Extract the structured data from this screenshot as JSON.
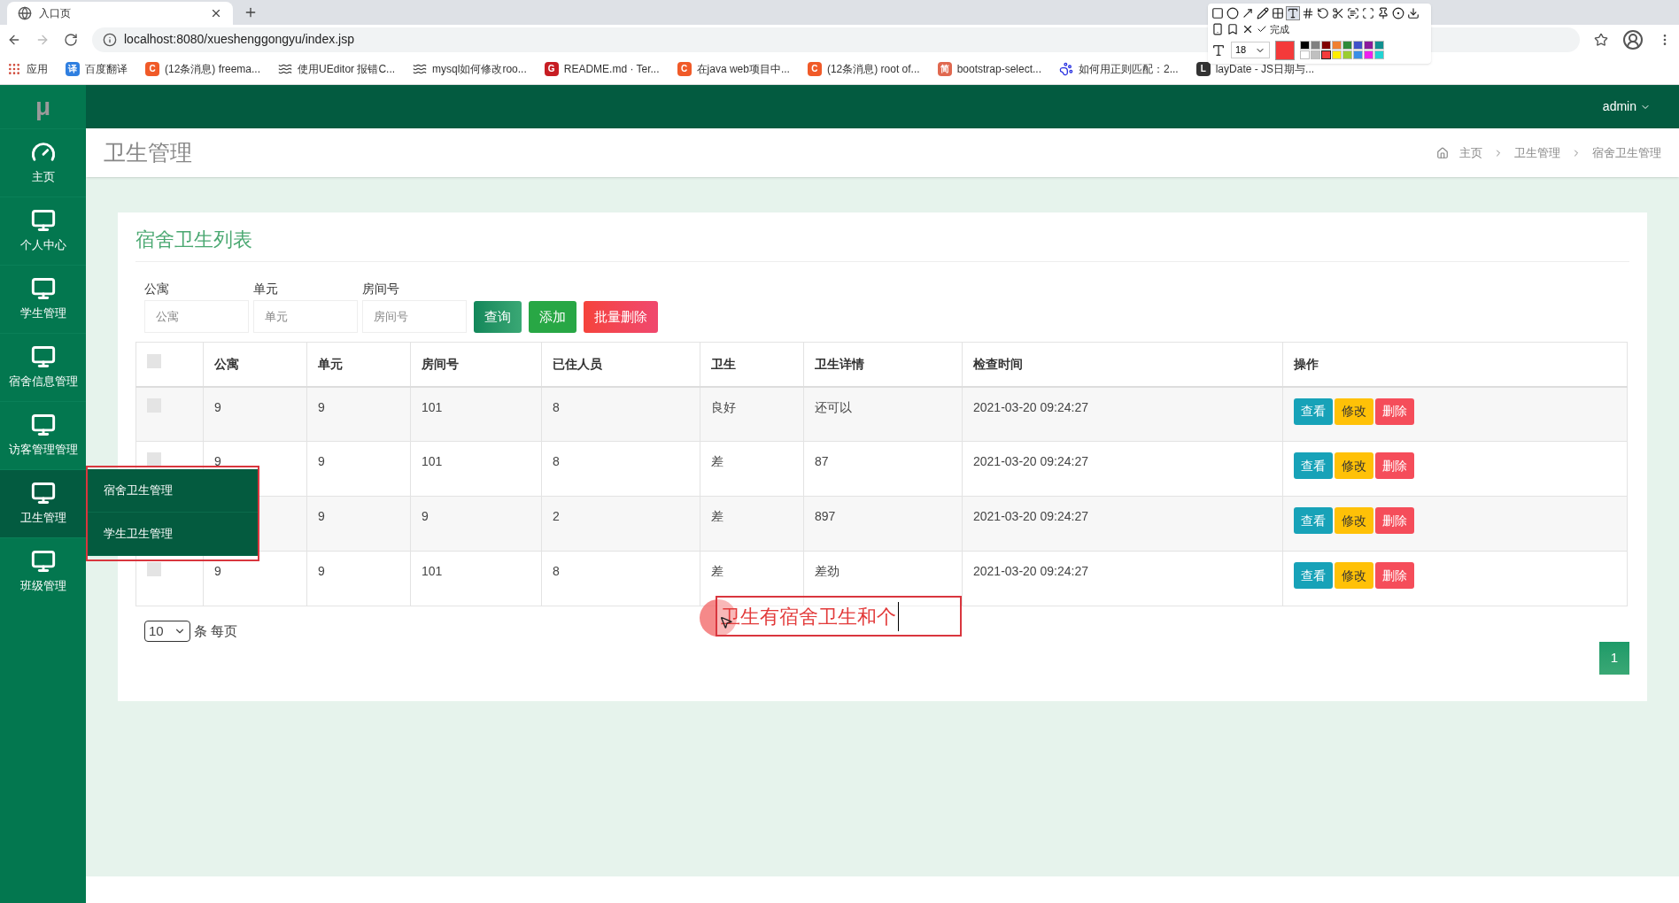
{
  "browser": {
    "tab_title": "入口页",
    "url": "localhost:8080/xueshenggongyu/index.jsp",
    "bookmarks": [
      {
        "label": "应用",
        "kind": "apps"
      },
      {
        "label": "百度翻译",
        "kind": "letter",
        "glyph": "译",
        "color": "#2f7fe0"
      },
      {
        "label": "(12条消息) freema...",
        "kind": "letter",
        "glyph": "C",
        "color": "#f05a28"
      },
      {
        "label": "使用UEditor 报错C...",
        "kind": "swirl"
      },
      {
        "label": "mysql如何修改roo...",
        "kind": "swirl"
      },
      {
        "label": "README.md · Ter...",
        "kind": "letter",
        "glyph": "G",
        "color": "#c71d23"
      },
      {
        "label": "在java web项目中...",
        "kind": "letter",
        "glyph": "C",
        "color": "#f05a28"
      },
      {
        "label": "(12条消息) root of...",
        "kind": "letter",
        "glyph": "C",
        "color": "#f05a28"
      },
      {
        "label": "bootstrap-select...",
        "kind": "letter",
        "glyph": "简",
        "color": "#e0684f"
      },
      {
        "label": "如何用正则匹配：2...",
        "kind": "paw"
      },
      {
        "label": "layDate - JS日期与...",
        "kind": "letter",
        "glyph": "L",
        "color": "#333333"
      }
    ]
  },
  "capture_toolbar": {
    "tools": [
      {
        "kind": "rect",
        "selected": false
      },
      {
        "kind": "circle",
        "selected": false
      },
      {
        "kind": "arrow",
        "selected": false
      },
      {
        "kind": "pen",
        "selected": false
      },
      {
        "kind": "mosaic",
        "selected": false
      },
      {
        "kind": "text",
        "selected": true
      },
      {
        "kind": "number",
        "selected": false
      },
      {
        "kind": "undo",
        "selected": false
      },
      {
        "kind": "cut",
        "selected": false
      },
      {
        "kind": "ocr",
        "selected": false
      },
      {
        "kind": "scan",
        "selected": false
      },
      {
        "kind": "pin",
        "selected": false
      },
      {
        "kind": "record",
        "selected": false
      },
      {
        "kind": "download",
        "selected": false
      },
      {
        "kind": "phone",
        "selected": false
      },
      {
        "kind": "bookmark",
        "selected": false
      },
      {
        "kind": "close",
        "selected": false
      }
    ],
    "done_label": "完成",
    "font_size": "18",
    "palette": [
      {
        "color": "#000000",
        "selected": false
      },
      {
        "color": "#808080",
        "selected": false
      },
      {
        "color": "#800000",
        "selected": false
      },
      {
        "color": "#f08030",
        "selected": false
      },
      {
        "color": "#2e8b3a",
        "selected": false
      },
      {
        "color": "#3f51c8",
        "selected": false
      },
      {
        "color": "#8b1a9b",
        "selected": false
      },
      {
        "color": "#109090",
        "selected": false
      },
      {
        "color": "#ffffff",
        "selected": false
      },
      {
        "color": "#c0c0c0",
        "selected": false
      },
      {
        "color": "#f43a3a",
        "selected": true
      },
      {
        "color": "#ffee00",
        "selected": false
      },
      {
        "color": "#9acd32",
        "selected": false
      },
      {
        "color": "#3a8ee6",
        "selected": false
      },
      {
        "color": "#ee22ee",
        "selected": false
      },
      {
        "color": "#22d3d3",
        "selected": false
      }
    ]
  },
  "app": {
    "logo": "μ",
    "user": "admin",
    "sidebar": [
      {
        "label": "主页",
        "kind": "dashboard",
        "selected": false
      },
      {
        "label": "个人中心",
        "kind": "monitor",
        "selected": false
      },
      {
        "label": "学生管理",
        "kind": "monitor",
        "selected": false
      },
      {
        "label": "宿舍信息管理",
        "kind": "monitor",
        "selected": false
      },
      {
        "label": "访客管理管理",
        "kind": "monitor",
        "selected": false
      },
      {
        "label": "卫生管理",
        "kind": "monitor",
        "selected": true
      },
      {
        "label": "班级管理",
        "kind": "monitor",
        "selected": false
      }
    ],
    "flyout": [
      "宿舍卫生管理",
      "学生卫生管理"
    ],
    "page_title": "卫生管理",
    "breadcrumb": [
      "主页",
      "卫生管理",
      "宿舍卫生管理"
    ]
  },
  "card": {
    "title": "宿舍卫生列表",
    "filters": [
      {
        "label": "公寓",
        "placeholder": "公寓"
      },
      {
        "label": "单元",
        "placeholder": "单元"
      },
      {
        "label": "房间号",
        "placeholder": "房间号"
      }
    ],
    "buttons": [
      {
        "label": "查询",
        "kind": "search"
      },
      {
        "label": "添加",
        "kind": "add"
      },
      {
        "label": "批量删除",
        "kind": "delete"
      }
    ],
    "columns": [
      "公寓",
      "单元",
      "房间号",
      "已住人员",
      "卫生",
      "卫生详情",
      "检查时间",
      "操作"
    ],
    "header_checked": false,
    "rows": [
      {
        "checked": false,
        "cells": [
          "9",
          "9",
          "101",
          "8",
          "良好",
          "还可以",
          "2021-03-20 09:24:27"
        ],
        "actions": [
          {
            "label": "查看",
            "kind": "view"
          },
          {
            "label": "修改",
            "kind": "edit"
          },
          {
            "label": "删除",
            "kind": "delete"
          }
        ]
      },
      {
        "checked": false,
        "cells": [
          "9",
          "9",
          "101",
          "8",
          "差",
          "87",
          "2021-03-20 09:24:27"
        ],
        "actions": [
          {
            "label": "查看",
            "kind": "view"
          },
          {
            "label": "修改",
            "kind": "edit"
          },
          {
            "label": "删除",
            "kind": "delete"
          }
        ]
      },
      {
        "cells": [
          null,
          "9",
          "9",
          "2",
          "差",
          "897",
          "2021-03-20 09:24:27"
        ],
        "actions": [
          {
            "label": "查看",
            "kind": "view"
          },
          {
            "label": "修改",
            "kind": "edit"
          },
          {
            "label": "删除",
            "kind": "delete"
          }
        ]
      },
      {
        "checked": false,
        "cells": [
          "9",
          "9",
          "101",
          "8",
          "差",
          "差劲",
          "2021-03-20 09:24:27"
        ],
        "actions": [
          {
            "label": "查看",
            "kind": "view"
          },
          {
            "label": "修改",
            "kind": "edit"
          },
          {
            "label": "删除",
            "kind": "delete"
          }
        ]
      }
    ],
    "page_size": "10",
    "page_size_suffix": "条 每页",
    "pages": [
      {
        "label": "1",
        "selected": true
      }
    ]
  },
  "annotation": {
    "text": "卫生有宿舍卫生和个"
  }
}
